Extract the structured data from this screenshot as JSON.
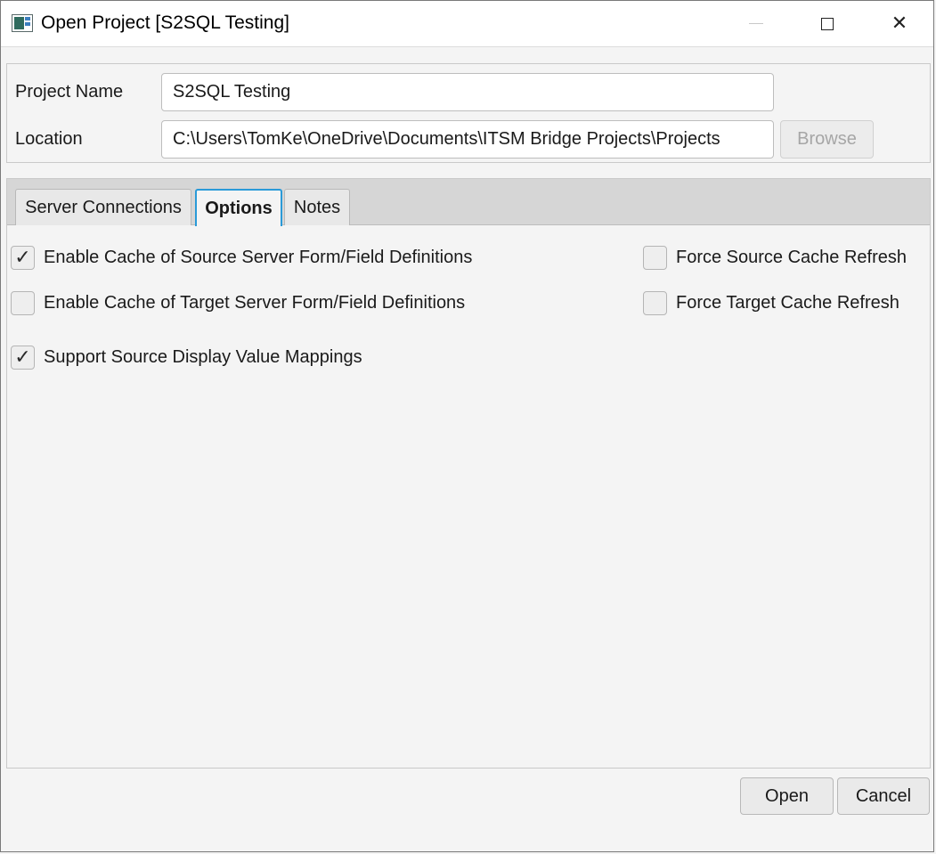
{
  "window": {
    "title": "Open Project [S2SQL Testing]",
    "app_icon": "app-window-icon",
    "controls": {
      "minimize": "minimize-icon",
      "maximize": "maximize-icon",
      "close": "close-icon",
      "close_glyph": "✕"
    }
  },
  "project": {
    "name_label": "Project Name",
    "name_value": "S2SQL Testing",
    "location_label": "Location",
    "location_value": "C:\\Users\\TomKe\\OneDrive\\Documents\\ITSM Bridge Projects\\Projects",
    "browse_label": "Browse",
    "browse_enabled": false
  },
  "tabs": [
    {
      "label": "Server Connections",
      "active": false
    },
    {
      "label": "Options",
      "active": true
    },
    {
      "label": "Notes",
      "active": false
    }
  ],
  "options": {
    "check_glyph": "✓",
    "items": [
      {
        "label": "Enable Cache of Source Server Form/Field Definitions",
        "checked": true
      },
      {
        "label": "Enable Cache of Target Server Form/Field Definitions",
        "checked": false
      },
      {
        "label": "Support Source Display Value Mappings",
        "checked": true
      },
      {
        "label": "Force Source Cache Refresh",
        "checked": false
      },
      {
        "label": "Force Target Cache Refresh",
        "checked": false
      }
    ]
  },
  "actions": {
    "open_label": "Open",
    "cancel_label": "Cancel"
  },
  "colors": {
    "active_tab_border": "#2a9ad8",
    "background": "#f4f4f4"
  }
}
